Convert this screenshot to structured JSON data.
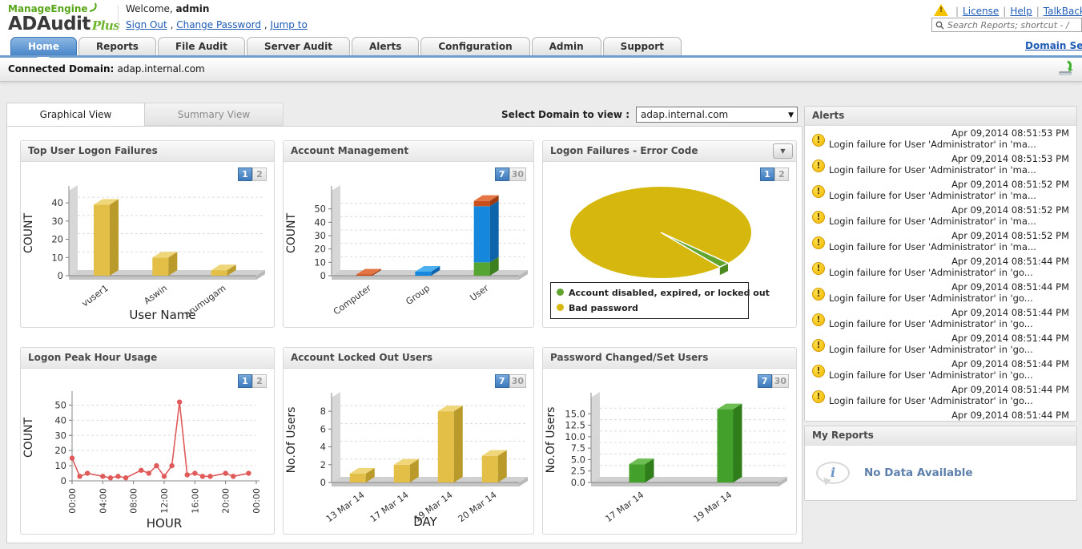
{
  "branding": {
    "company": "ManageEngine",
    "product": "ADAudit",
    "edition": "Plus"
  },
  "header": {
    "welcome_label": "Welcome,",
    "username": "admin",
    "session_links": [
      "Sign Out",
      "Change Password",
      "Jump to"
    ],
    "top_links": [
      "License",
      "Help",
      "TalkBack"
    ],
    "search": {
      "placeholder": "Search Reports; shortcut - /"
    },
    "domain_settings_label": "Domain Settings",
    "warning_glyph": "!"
  },
  "nav": {
    "tabs": [
      {
        "label": "Home",
        "active": true
      },
      {
        "label": "Reports",
        "active": false
      },
      {
        "label": "File Audit",
        "active": false
      },
      {
        "label": "Server Audit",
        "active": false
      },
      {
        "label": "Alerts",
        "active": false
      },
      {
        "label": "Configuration",
        "active": false
      },
      {
        "label": "Admin",
        "active": false
      },
      {
        "label": "Support",
        "active": false
      }
    ]
  },
  "domain_bar": {
    "label": "Connected Domain:",
    "value": "adap.internal.com"
  },
  "view_tabs": [
    {
      "label": "Graphical View",
      "active": true
    },
    {
      "label": "Summary View",
      "active": false
    }
  ],
  "domain_select": {
    "label": "Select Domain to view :",
    "value": "adap.internal.com",
    "caret": "▼"
  },
  "alerts": {
    "title": "Alerts",
    "items": [
      {
        "time": "Apr 09,2014 08:51:53 PM",
        "text": "Login failure for User 'Administrator' in 'ma..."
      },
      {
        "time": "Apr 09,2014 08:51:53 PM",
        "text": "Login failure for User 'Administrator' in 'ma..."
      },
      {
        "time": "Apr 09,2014 08:51:52 PM",
        "text": "Login failure for User 'Administrator' in 'ma..."
      },
      {
        "time": "Apr 09,2014 08:51:52 PM",
        "text": "Login failure for User 'Administrator' in 'ma..."
      },
      {
        "time": "Apr 09,2014 08:51:52 PM",
        "text": "Login failure for User 'Administrator' in 'ma..."
      },
      {
        "time": "Apr 09,2014 08:51:44 PM",
        "text": "Login failure for User 'Administrator' in 'go..."
      },
      {
        "time": "Apr 09,2014 08:51:44 PM",
        "text": "Login failure for User 'Administrator' in 'go..."
      },
      {
        "time": "Apr 09,2014 08:51:44 PM",
        "text": "Login failure for User 'Administrator' in 'go..."
      },
      {
        "time": "Apr 09,2014 08:51:44 PM",
        "text": "Login failure for User 'Administrator' in 'go..."
      },
      {
        "time": "Apr 09,2014 08:51:44 PM",
        "text": "Login failure for User 'Administrator' in 'go..."
      },
      {
        "time": "Apr 09,2014 08:51:44 PM",
        "text": "Login failure for User 'Administrator' in 'go..."
      },
      {
        "time": "Apr 09,2014 08:51:44 PM",
        "text": "",
        "partial": true
      }
    ]
  },
  "my_reports": {
    "title": "My Reports",
    "empty_text": "No Data Available",
    "icon_glyph": "i"
  },
  "chart_data": [
    {
      "id": "top-user-logon-failures",
      "type": "bar",
      "title": "Top User Logon Failures",
      "pager": [
        "1",
        "2"
      ],
      "pager_active": 0,
      "categories": [
        "vuser1",
        "Aswin",
        "arumugam"
      ],
      "values": [
        39,
        10,
        3
      ],
      "xlabel": "User Name",
      "ylabel": "COUNT",
      "yticks": [
        "0",
        "10",
        "20",
        "30",
        "40"
      ],
      "ytick_vals": [
        0,
        10,
        20,
        30,
        40
      ],
      "ylim": [
        0,
        44
      ],
      "colors": {
        "front": "#e3bf47",
        "top": "#eed679",
        "side": "#ba9a2b"
      }
    },
    {
      "id": "account-management",
      "type": "stacked-bar",
      "title": "Account Management",
      "pager": [
        "7",
        "30"
      ],
      "pager_active": 0,
      "categories": [
        "Computer",
        "Group",
        "User"
      ],
      "series": [
        {
          "name": "green",
          "values": [
            0,
            0,
            10
          ],
          "front": "#55a532",
          "top": "#79c457",
          "side": "#3c7f1f"
        },
        {
          "name": "blue",
          "values": [
            0,
            3,
            42
          ],
          "front": "#1588de",
          "top": "#4fb0ef",
          "side": "#0d64ab"
        },
        {
          "name": "red",
          "values": [
            0.4,
            0,
            4
          ],
          "front": "#c94f1d",
          "top": "#e37544",
          "side": "#9c3a11"
        }
      ],
      "xlabel": "",
      "ylabel": "COUNT",
      "yticks": [
        "0",
        "10",
        "20",
        "30",
        "40",
        "50"
      ],
      "ytick_vals": [
        0,
        10,
        20,
        30,
        40,
        50
      ],
      "ylim": [
        0,
        60
      ]
    },
    {
      "id": "logon-failures-error-code",
      "type": "pie",
      "title": "Logon Failures - Error Code",
      "pager": [
        "1",
        "2"
      ],
      "pager_active": 0,
      "has_menu_button": true,
      "menu_glyph": "▼",
      "slices": [
        {
          "label": "Account disabled, expired, or locked out",
          "value": 2,
          "color": "#61a42e",
          "side": "#4a8a1f"
        },
        {
          "label": "Bad password",
          "value": 98,
          "color": "#d6b70d",
          "side": "#b89c08"
        }
      ]
    },
    {
      "id": "logon-peak-hour-usage",
      "type": "line",
      "title": "Logon Peak Hour Usage",
      "pager": [
        "1",
        "2"
      ],
      "pager_active": 0,
      "x": [
        0,
        1,
        2,
        4,
        5,
        6,
        7,
        9,
        10,
        11,
        12,
        13,
        14,
        15,
        16,
        17,
        18,
        20,
        21,
        23
      ],
      "values": [
        15,
        3,
        5,
        3,
        2,
        3,
        2,
        7,
        5,
        10,
        3,
        10,
        52,
        4,
        5,
        3,
        3,
        5,
        3,
        5
      ],
      "xticks": [
        "00:00",
        "04:00",
        "08:00",
        "12:00",
        "16:00",
        "20:00",
        "00:00"
      ],
      "xtick_vals": [
        0,
        4,
        8,
        12,
        16,
        20,
        24
      ],
      "xmax": 24,
      "xlabel": "HOUR",
      "ylabel": "COUNT",
      "yticks": [
        "0",
        "10",
        "20",
        "30",
        "40",
        "50"
      ],
      "ytick_vals": [
        0,
        10,
        20,
        30,
        40,
        50
      ],
      "ylim": [
        0,
        55
      ],
      "line_color": "#e05a5a"
    },
    {
      "id": "account-locked-out-users",
      "type": "bar",
      "title": "Account Locked Out Users",
      "pager": [
        "7",
        "30"
      ],
      "pager_active": 0,
      "categories": [
        "13 Mar 14",
        "17 Mar 14",
        "19 Mar 14",
        "20 Mar 14"
      ],
      "values": [
        1,
        2,
        8,
        3
      ],
      "xlabel": "DAY",
      "ylabel": "No.Of Users",
      "yticks": [
        "0",
        "2",
        "4",
        "6",
        "8"
      ],
      "ytick_vals": [
        0,
        2,
        4,
        6,
        8
      ],
      "ylim": [
        0,
        9
      ],
      "colors": {
        "front": "#e3bf47",
        "top": "#eed679",
        "side": "#ba9a2b"
      }
    },
    {
      "id": "password-changed-set-users",
      "type": "bar",
      "title": "Password Changed/Set Users",
      "pager": [
        "7",
        "30"
      ],
      "pager_active": 0,
      "categories": [
        "17 Mar 14",
        "19 Mar 14"
      ],
      "values": [
        4,
        16
      ],
      "xlabel": "",
      "ylabel": "No.Of Users",
      "yticks": [
        "0.0",
        "2.5",
        "5.0",
        "7.5",
        "10.0",
        "12.5",
        "15.0"
      ],
      "ytick_vals": [
        0,
        2.5,
        5,
        7.5,
        10,
        12.5,
        15
      ],
      "ylim": [
        0,
        17.5
      ],
      "colors": {
        "front": "#43a02a",
        "top": "#6cbd52",
        "side": "#2f7d1b"
      }
    }
  ]
}
